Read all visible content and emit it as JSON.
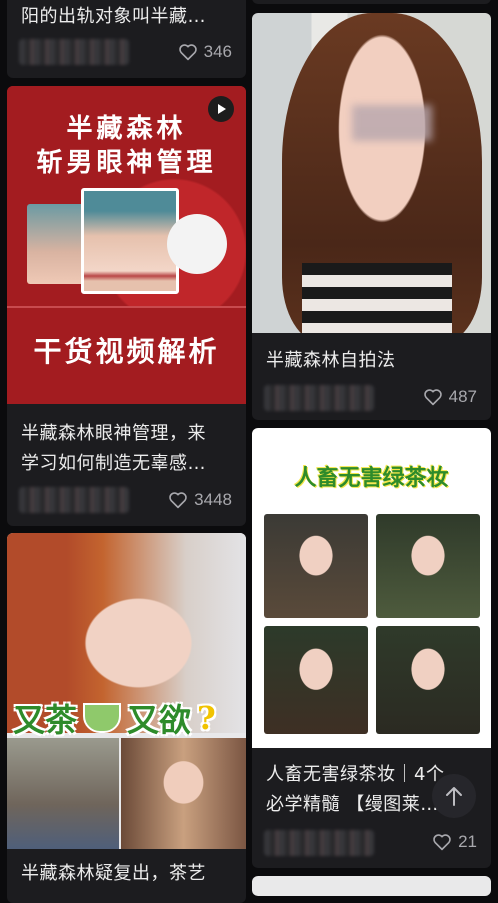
{
  "cards": {
    "top_left": {
      "title": "阳的出轨对象叫半藏…",
      "likes": "346"
    },
    "video": {
      "banner_line1": "半藏森林",
      "banner_line2": "斩男眼神管理",
      "banner_bottom": "干货视频解析",
      "title_line1": "半藏森林眼神管理，来",
      "title_line2": "学习如何制造无辜感…",
      "likes": "3448"
    },
    "selfie": {
      "title": "半藏森林自拍法",
      "likes": "487"
    },
    "green_tea": {
      "banner": "人畜无害绿茶妆",
      "title_line1": "人畜无害绿茶妆｜4个",
      "title_line2": "必学精髓 【缦图莱…",
      "likes": "21"
    },
    "bottom_left": {
      "overlay_a": "又茶",
      "overlay_b": "又欲",
      "overlay_q": "?",
      "title": "半藏森林疑复出，茶艺"
    }
  },
  "icons": {
    "heart": "heart-outline-icon",
    "play": "play-icon",
    "scroll_top": "arrow-up-icon"
  },
  "colors": {
    "background": "#0b0b0d",
    "card": "#1c1c1f",
    "banner_red": "#9b1b1f",
    "green_text": "#2e8b2a"
  }
}
